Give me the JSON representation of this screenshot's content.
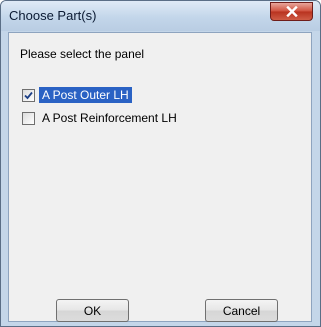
{
  "window": {
    "title": "Choose Part(s)"
  },
  "dialog": {
    "prompt": "Please select the panel",
    "options": [
      {
        "label": "A Post Outer LH",
        "checked": true,
        "selected": true
      },
      {
        "label": "A Post Reinforcement LH",
        "checked": false,
        "selected": false
      }
    ],
    "ok_label": "OK",
    "cancel_label": "Cancel"
  },
  "colors": {
    "selection_highlight": "#2a62c4",
    "close_button": "#c8452f",
    "titlebar": "#c4d6e9"
  },
  "icons": {
    "close": "close-icon",
    "check": "checkmark-icon"
  }
}
